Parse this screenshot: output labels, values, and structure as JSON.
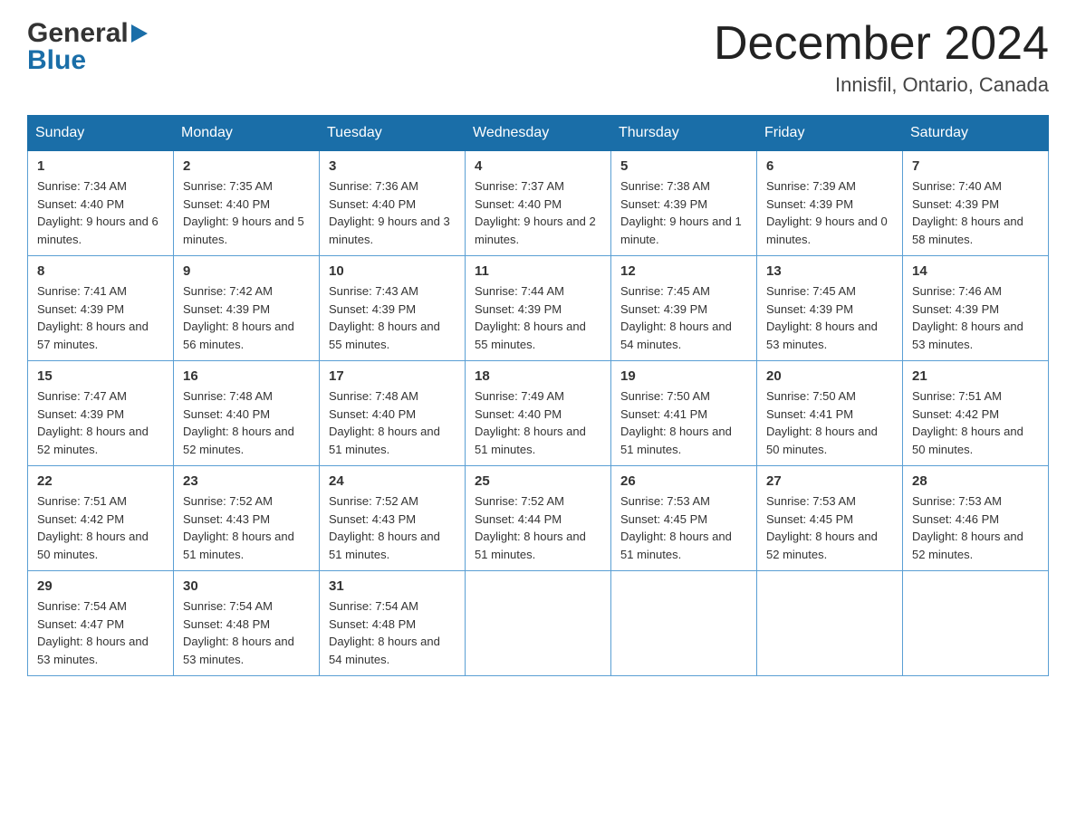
{
  "header": {
    "logo_general": "General",
    "logo_blue": "Blue",
    "month_title": "December 2024",
    "location": "Innisfil, Ontario, Canada"
  },
  "days_of_week": [
    "Sunday",
    "Monday",
    "Tuesday",
    "Wednesday",
    "Thursday",
    "Friday",
    "Saturday"
  ],
  "weeks": [
    [
      {
        "day": "1",
        "sunrise": "7:34 AM",
        "sunset": "4:40 PM",
        "daylight": "9 hours and 6 minutes."
      },
      {
        "day": "2",
        "sunrise": "7:35 AM",
        "sunset": "4:40 PM",
        "daylight": "9 hours and 5 minutes."
      },
      {
        "day": "3",
        "sunrise": "7:36 AM",
        "sunset": "4:40 PM",
        "daylight": "9 hours and 3 minutes."
      },
      {
        "day": "4",
        "sunrise": "7:37 AM",
        "sunset": "4:40 PM",
        "daylight": "9 hours and 2 minutes."
      },
      {
        "day": "5",
        "sunrise": "7:38 AM",
        "sunset": "4:39 PM",
        "daylight": "9 hours and 1 minute."
      },
      {
        "day": "6",
        "sunrise": "7:39 AM",
        "sunset": "4:39 PM",
        "daylight": "9 hours and 0 minutes."
      },
      {
        "day": "7",
        "sunrise": "7:40 AM",
        "sunset": "4:39 PM",
        "daylight": "8 hours and 58 minutes."
      }
    ],
    [
      {
        "day": "8",
        "sunrise": "7:41 AM",
        "sunset": "4:39 PM",
        "daylight": "8 hours and 57 minutes."
      },
      {
        "day": "9",
        "sunrise": "7:42 AM",
        "sunset": "4:39 PM",
        "daylight": "8 hours and 56 minutes."
      },
      {
        "day": "10",
        "sunrise": "7:43 AM",
        "sunset": "4:39 PM",
        "daylight": "8 hours and 55 minutes."
      },
      {
        "day": "11",
        "sunrise": "7:44 AM",
        "sunset": "4:39 PM",
        "daylight": "8 hours and 55 minutes."
      },
      {
        "day": "12",
        "sunrise": "7:45 AM",
        "sunset": "4:39 PM",
        "daylight": "8 hours and 54 minutes."
      },
      {
        "day": "13",
        "sunrise": "7:45 AM",
        "sunset": "4:39 PM",
        "daylight": "8 hours and 53 minutes."
      },
      {
        "day": "14",
        "sunrise": "7:46 AM",
        "sunset": "4:39 PM",
        "daylight": "8 hours and 53 minutes."
      }
    ],
    [
      {
        "day": "15",
        "sunrise": "7:47 AM",
        "sunset": "4:39 PM",
        "daylight": "8 hours and 52 minutes."
      },
      {
        "day": "16",
        "sunrise": "7:48 AM",
        "sunset": "4:40 PM",
        "daylight": "8 hours and 52 minutes."
      },
      {
        "day": "17",
        "sunrise": "7:48 AM",
        "sunset": "4:40 PM",
        "daylight": "8 hours and 51 minutes."
      },
      {
        "day": "18",
        "sunrise": "7:49 AM",
        "sunset": "4:40 PM",
        "daylight": "8 hours and 51 minutes."
      },
      {
        "day": "19",
        "sunrise": "7:50 AM",
        "sunset": "4:41 PM",
        "daylight": "8 hours and 51 minutes."
      },
      {
        "day": "20",
        "sunrise": "7:50 AM",
        "sunset": "4:41 PM",
        "daylight": "8 hours and 50 minutes."
      },
      {
        "day": "21",
        "sunrise": "7:51 AM",
        "sunset": "4:42 PM",
        "daylight": "8 hours and 50 minutes."
      }
    ],
    [
      {
        "day": "22",
        "sunrise": "7:51 AM",
        "sunset": "4:42 PM",
        "daylight": "8 hours and 50 minutes."
      },
      {
        "day": "23",
        "sunrise": "7:52 AM",
        "sunset": "4:43 PM",
        "daylight": "8 hours and 51 minutes."
      },
      {
        "day": "24",
        "sunrise": "7:52 AM",
        "sunset": "4:43 PM",
        "daylight": "8 hours and 51 minutes."
      },
      {
        "day": "25",
        "sunrise": "7:52 AM",
        "sunset": "4:44 PM",
        "daylight": "8 hours and 51 minutes."
      },
      {
        "day": "26",
        "sunrise": "7:53 AM",
        "sunset": "4:45 PM",
        "daylight": "8 hours and 51 minutes."
      },
      {
        "day": "27",
        "sunrise": "7:53 AM",
        "sunset": "4:45 PM",
        "daylight": "8 hours and 52 minutes."
      },
      {
        "day": "28",
        "sunrise": "7:53 AM",
        "sunset": "4:46 PM",
        "daylight": "8 hours and 52 minutes."
      }
    ],
    [
      {
        "day": "29",
        "sunrise": "7:54 AM",
        "sunset": "4:47 PM",
        "daylight": "8 hours and 53 minutes."
      },
      {
        "day": "30",
        "sunrise": "7:54 AM",
        "sunset": "4:48 PM",
        "daylight": "8 hours and 53 minutes."
      },
      {
        "day": "31",
        "sunrise": "7:54 AM",
        "sunset": "4:48 PM",
        "daylight": "8 hours and 54 minutes."
      },
      null,
      null,
      null,
      null
    ]
  ],
  "labels": {
    "sunrise": "Sunrise:",
    "sunset": "Sunset:",
    "daylight": "Daylight:"
  }
}
